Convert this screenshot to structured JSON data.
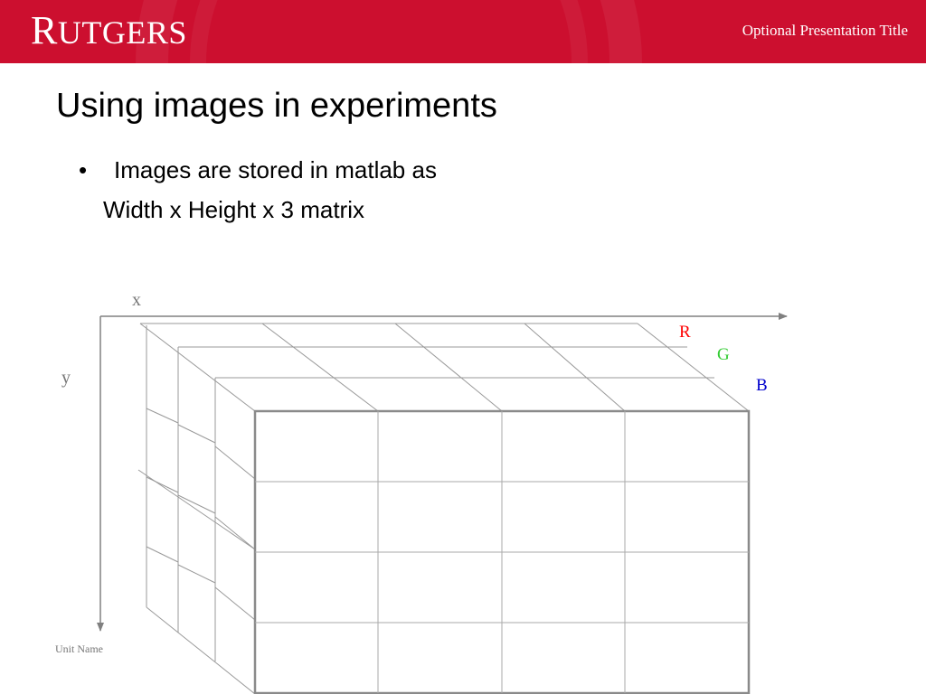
{
  "header": {
    "logo_text": "RUTGERS",
    "presentation_title": "Optional Presentation Title",
    "background_color": "#cc0f2f"
  },
  "slide": {
    "title": "Using images in experiments",
    "bullet": "•",
    "bullet_line1": "Images are stored in matlab as",
    "bullet_line2": "Width x Height x 3 matrix"
  },
  "diagram": {
    "x_axis_label": "x",
    "y_axis_label": "y",
    "channels": [
      {
        "label": "R",
        "color": "#ff0000"
      },
      {
        "label": "G",
        "color": "#33cc33"
      },
      {
        "label": "B",
        "color": "#0000cc"
      }
    ],
    "grid_columns": 4,
    "grid_rows": 4
  },
  "footer": {
    "unit_name": "Unit Name"
  }
}
